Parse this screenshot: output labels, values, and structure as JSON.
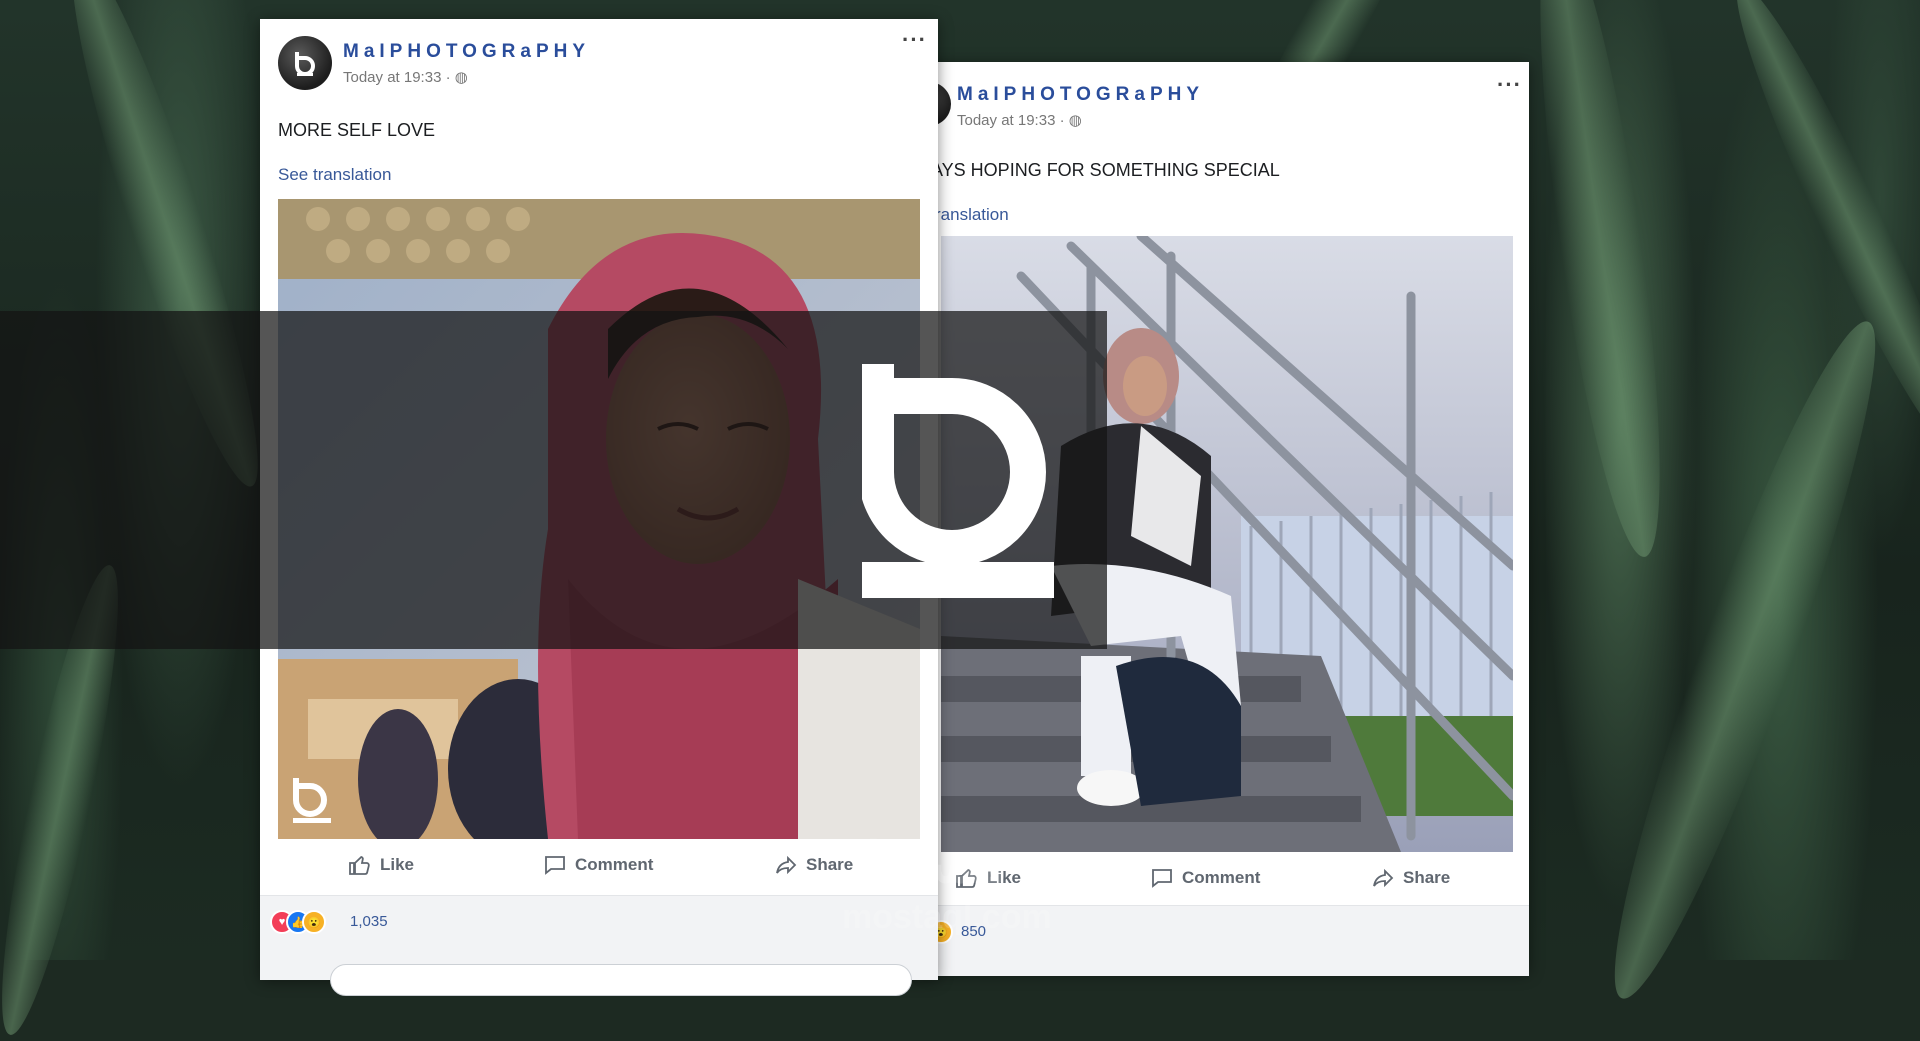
{
  "background": {
    "color": "#1d2a22"
  },
  "posts": [
    {
      "page_name": "MaIPHOTOGRaPHY",
      "timestamp": "Today at 19:33 · ",
      "more_icon": "more-horizontal-icon",
      "text": "MORE SELF LOVE",
      "see_translation": "See translation",
      "actions": {
        "like": "Like",
        "comment": "Comment",
        "share": "Share"
      },
      "reactions": [
        "love",
        "like",
        "wow"
      ],
      "reaction_count": "1,035"
    },
    {
      "page_name": "MaIPHOTOGRaPHY",
      "timestamp": "Today at 19:33 · ",
      "more_icon": "more-horizontal-icon",
      "text": "AYS HOPING FOR SOMETHING SPECIAL",
      "see_translation": "ranslation",
      "actions": {
        "like": "Like",
        "comment": "Comment",
        "share": "Share"
      },
      "reactions": [
        "wow"
      ],
      "reaction_count": "850"
    }
  ],
  "watermark": {
    "arabic": "مستقل",
    "latin": "mostaql.com"
  },
  "colors": {
    "link": "#385898",
    "page_name": "#2a4d9b",
    "overlay": "#141414"
  }
}
